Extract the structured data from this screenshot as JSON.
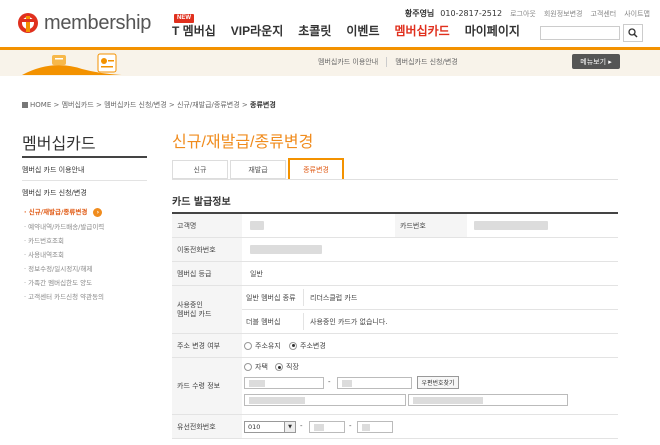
{
  "brand": {
    "logo_text": "membership"
  },
  "header": {
    "nav": [
      {
        "label": "T 멤버십",
        "badge": "NEW"
      },
      {
        "label": "VIP라운지"
      },
      {
        "label": "초콜릿"
      },
      {
        "label": "이벤트"
      },
      {
        "label": "멤버십카드",
        "active": true
      },
      {
        "label": "마이페이지"
      }
    ],
    "util": {
      "user_name": "황주영님",
      "phone": "010-2817-2512",
      "links": [
        "로그아웃",
        "회원정보변경",
        "고객센터",
        "사이트맵"
      ]
    },
    "search": {
      "placeholder": ""
    }
  },
  "band": {
    "links": [
      "멤버십카드 이용안내",
      "멤버십카드 신청/변경"
    ],
    "menu_button": "메뉴보기 ▸"
  },
  "breadcrumb": {
    "items": [
      "HOME",
      "멤버십카드",
      "멤버십카드 신청/변경",
      "신규/재발급/종류변경"
    ],
    "current": "종류변경"
  },
  "sidebar": {
    "title": "멤버십카드",
    "items": [
      "멤버십 카드 이용안내",
      "멤버십 카드 신청/변경"
    ],
    "subitems": [
      {
        "label": "신규/재발급/종류변경",
        "active": true
      },
      {
        "label": "예약내역/카드배송/발급이력"
      },
      {
        "label": "카드번호조회"
      },
      {
        "label": "사용내역조회"
      },
      {
        "label": "정보수정/일시정지/해제"
      },
      {
        "label": "가족간 멤버십한도 양도"
      },
      {
        "label": "고객센터 카드신청 약관동의"
      }
    ]
  },
  "main": {
    "title": "신규/재발급/종류변경",
    "tabs": [
      {
        "label": "신규"
      },
      {
        "label": "재발급"
      },
      {
        "label": "종류변경",
        "active": true
      }
    ],
    "section_title": "카드 발급정보",
    "table": {
      "customer_name_label": "고객명",
      "card_number_label": "카드번호",
      "mobile_label": "이동전화번호",
      "grade_label": "멤버십 등급",
      "grade_value": "일반",
      "using_card_label": "사용중인\n멤버십 카드",
      "general_type_label": "일반 멤버십 종류",
      "general_type_value": "리더스클럽 카드",
      "double_label": "더블 멤버십",
      "double_value": "사용중인 카드가 없습니다.",
      "address_change_label": "주소 변경 여부",
      "address_options": [
        "주소유지",
        "주소변경"
      ],
      "address_selected": "주소변경",
      "receive_label": "카드 수령 정보",
      "receive_options": [
        "자택",
        "직장"
      ],
      "receive_selected": "직장",
      "zip_dash": "-",
      "zip_button": "우편번호찾기",
      "landline_label": "유선전화번호",
      "landline_area": "010",
      "landline_dash": "-"
    }
  },
  "colors": {
    "accent": "#f39200",
    "brand_red": "#e0301e",
    "title_orange": "#f08c1e"
  }
}
